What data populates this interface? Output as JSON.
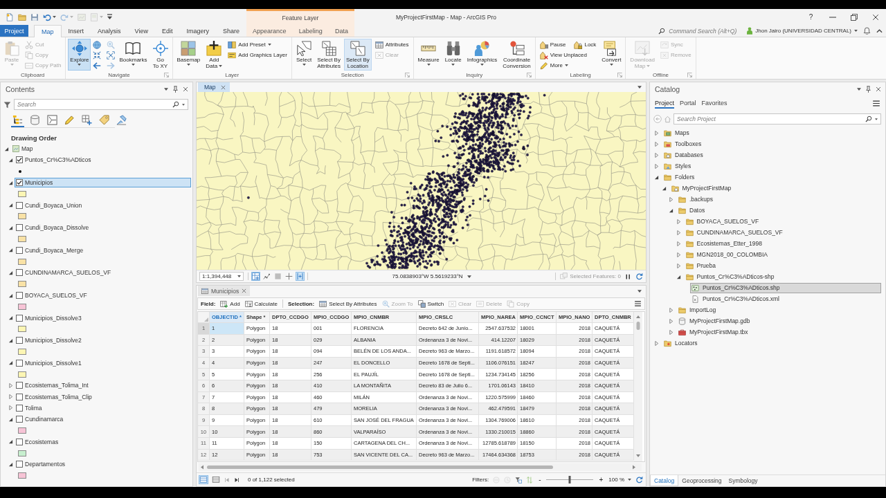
{
  "window": {
    "title": "MyProjectFirstMap - Map - ArcGIS Pro",
    "context_header": "Feature Layer",
    "help": "?"
  },
  "quick_access": [
    {
      "disabled": false,
      "dropdown": false
    },
    {
      "disabled": false,
      "dropdown": false
    },
    {
      "disabled": false,
      "dropdown": false
    },
    {
      "disabled": false,
      "dropdown": true
    },
    {
      "disabled": true,
      "dropdown": true
    },
    {
      "disabled": true,
      "dropdown": false
    },
    {
      "disabled": true,
      "dropdown": true
    },
    {
      "disabled": false,
      "dropdown": false
    }
  ],
  "tabs": [
    {
      "label": "Project",
      "kind": "backstage",
      "selected": false
    },
    {
      "label": "Map",
      "kind": "core",
      "selected": true
    },
    {
      "label": "Insert",
      "kind": "core",
      "selected": false
    },
    {
      "label": "Analysis",
      "kind": "core",
      "selected": false
    },
    {
      "label": "View",
      "kind": "core",
      "selected": false
    },
    {
      "label": "Edit",
      "kind": "core",
      "selected": false
    },
    {
      "label": "Imagery",
      "kind": "core",
      "selected": false
    },
    {
      "label": "Share",
      "kind": "core",
      "selected": false
    },
    {
      "label": "Appearance",
      "kind": "contextual",
      "selected": false
    },
    {
      "label": "Labeling",
      "kind": "contextual",
      "selected": false
    },
    {
      "label": "Data",
      "kind": "contextual",
      "selected": false
    }
  ],
  "command_search": {
    "placeholder": "Command Search (Alt+Q)"
  },
  "user": {
    "name": "Jhon Jairo (UNIVERSIDAD CENTRAL)"
  },
  "ribbon": [
    {
      "label": "Clipboard",
      "launcher": false,
      "columns": [
        {
          "kind": "large",
          "label": "Paste",
          "disabled": true,
          "selected": false,
          "hovered": false,
          "dropdown": true
        },
        {
          "kind": "stack",
          "rows": [
            [
              {
                "kind": "small",
                "label": "Cut",
                "disabled": true,
                "selected": false,
                "hovered": false,
                "dropdown": false
              }
            ],
            [
              {
                "kind": "small",
                "label": "Copy",
                "disabled": true,
                "selected": false,
                "hovered": false,
                "dropdown": false
              }
            ],
            [
              {
                "kind": "small",
                "label": "Copy Path",
                "disabled": true,
                "selected": false,
                "hovered": false,
                "dropdown": false
              }
            ]
          ]
        }
      ]
    },
    {
      "label": "Navigate",
      "launcher": true,
      "columns": [
        {
          "kind": "large",
          "label": "Explore",
          "disabled": false,
          "selected": true,
          "hovered": false,
          "dropdown": true
        },
        {
          "kind": "stack",
          "rows": [
            [
              {
                "kind": "icon",
                "disabled": false,
                "selected": false,
                "hovered": false
              },
              {
                "kind": "icon",
                "disabled": true,
                "selected": false,
                "hovered": false
              }
            ],
            [
              {
                "kind": "icon",
                "disabled": false,
                "selected": false,
                "hovered": false
              },
              {
                "kind": "icon",
                "disabled": false,
                "selected": false,
                "hovered": false
              }
            ],
            [
              {
                "kind": "icon",
                "disabled": false,
                "selected": false,
                "hovered": false
              },
              {
                "kind": "icon",
                "disabled": true,
                "selected": false,
                "hovered": false
              }
            ]
          ]
        },
        {
          "kind": "large",
          "label": "Bookmarks",
          "disabled": false,
          "selected": false,
          "hovered": false,
          "dropdown": true
        },
        {
          "kind": "large",
          "label": "Go\nTo XY",
          "disabled": false,
          "selected": false,
          "hovered": false,
          "dropdown": false
        }
      ]
    },
    {
      "label": "Layer",
      "launcher": false,
      "columns": [
        {
          "kind": "large",
          "label": "Basemap",
          "disabled": false,
          "selected": false,
          "hovered": false,
          "dropdown": true
        },
        {
          "kind": "large",
          "label": "Add\nData",
          "disabled": false,
          "selected": false,
          "hovered": false,
          "dropdown": true
        },
        {
          "kind": "stack",
          "rows": [
            [
              {
                "kind": "small",
                "label": "Add Preset",
                "disabled": false,
                "selected": false,
                "hovered": false,
                "dropdown": true
              }
            ],
            [
              {
                "kind": "small",
                "label": "Add Graphics Layer",
                "disabled": false,
                "selected": false,
                "hovered": false,
                "dropdown": false
              }
            ]
          ]
        }
      ]
    },
    {
      "label": "Selection",
      "launcher": true,
      "columns": [
        {
          "kind": "large",
          "label": "Select",
          "disabled": false,
          "selected": false,
          "hovered": false,
          "dropdown": true
        },
        {
          "kind": "large",
          "label": "Select By\nAttributes",
          "disabled": false,
          "selected": false,
          "hovered": false,
          "dropdown": false
        },
        {
          "kind": "large",
          "label": "Select By\nLocation",
          "disabled": false,
          "selected": false,
          "hovered": true,
          "dropdown": false
        },
        {
          "kind": "stack",
          "rows": [
            [
              {
                "kind": "small",
                "label": "Attributes",
                "disabled": false,
                "selected": false,
                "hovered": false,
                "dropdown": false
              }
            ],
            [
              {
                "kind": "small",
                "label": "Clear",
                "disabled": true,
                "selected": false,
                "hovered": false,
                "dropdown": false
              }
            ]
          ]
        }
      ]
    },
    {
      "label": "Inquiry",
      "launcher": true,
      "columns": [
        {
          "kind": "large",
          "label": "Measure",
          "disabled": false,
          "selected": false,
          "hovered": false,
          "dropdown": true
        },
        {
          "kind": "large",
          "label": "Locate",
          "disabled": false,
          "selected": false,
          "hovered": false,
          "dropdown": true
        },
        {
          "kind": "large",
          "label": "Infographics",
          "disabled": false,
          "selected": false,
          "hovered": false,
          "dropdown": true
        },
        {
          "kind": "large",
          "label": "Coordinate\nConversion",
          "disabled": false,
          "selected": false,
          "hovered": false,
          "dropdown": false
        }
      ]
    },
    {
      "label": "Labeling",
      "launcher": true,
      "columns": [
        {
          "kind": "stack",
          "rows": [
            [
              {
                "kind": "small",
                "label": "Pause",
                "disabled": false,
                "selected": false,
                "hovered": false,
                "dropdown": false
              },
              {
                "kind": "small",
                "label": "Lock",
                "disabled": false,
                "selected": false,
                "hovered": false,
                "dropdown": false
              }
            ],
            [
              {
                "kind": "small",
                "label": "View Unplaced",
                "disabled": false,
                "selected": false,
                "hovered": false,
                "dropdown": false
              }
            ],
            [
              {
                "kind": "small",
                "label": "More",
                "disabled": false,
                "selected": false,
                "hovered": false,
                "dropdown": true
              }
            ]
          ]
        },
        {
          "kind": "large",
          "label": "Convert",
          "disabled": false,
          "selected": false,
          "hovered": false,
          "dropdown": true
        }
      ]
    },
    {
      "label": "Offline",
      "launcher": true,
      "columns": [
        {
          "kind": "large",
          "label": "Download\nMap",
          "disabled": true,
          "selected": false,
          "hovered": false,
          "dropdown": true
        },
        {
          "kind": "stack",
          "rows": [
            [
              {
                "kind": "small",
                "label": "Sync",
                "disabled": true,
                "selected": false,
                "hovered": false,
                "dropdown": false
              }
            ],
            [
              {
                "kind": "small",
                "label": "Remove",
                "disabled": true,
                "selected": false,
                "hovered": false,
                "dropdown": false
              }
            ]
          ]
        }
      ]
    }
  ],
  "contents": {
    "title": "Contents",
    "search": {
      "placeholder": "Search"
    },
    "views": [
      {
        "selected": true
      },
      {
        "selected": false
      },
      {
        "selected": false
      },
      {
        "selected": false
      },
      {
        "selected": false
      },
      {
        "selected": false
      },
      {
        "selected": false
      }
    ],
    "heading": "Drawing Order",
    "map": {
      "name": "Map",
      "expanded": true,
      "children": [
        {
          "name": "Puntos_Cr%C3%ADticos",
          "checked": true,
          "expanded": true,
          "selected": false,
          "symbol": {
            "kind": "point",
            "color": "#111111"
          }
        },
        {
          "name": "Municipios",
          "checked": true,
          "expanded": true,
          "selected": true,
          "symbol": {
            "kind": "polygon",
            "color": "#fdf6b4"
          }
        },
        {
          "name": "Cundi_Boyaca_Union",
          "checked": false,
          "expanded": true,
          "selected": false,
          "symbol": {
            "kind": "polygon",
            "color": "#f9e2a6"
          }
        },
        {
          "name": "Cundi_Boyaca_Dissolve",
          "checked": false,
          "expanded": true,
          "selected": false,
          "symbol": {
            "kind": "polygon",
            "color": "#f9e2a6"
          }
        },
        {
          "name": "Cundi_Boyaca_Merge",
          "checked": false,
          "expanded": true,
          "selected": false,
          "symbol": {
            "kind": "polygon",
            "color": "#f9e2a6"
          }
        },
        {
          "name": "CUNDINAMARCA_SUELOS_VF",
          "checked": false,
          "expanded": true,
          "selected": false,
          "symbol": {
            "kind": "polygon",
            "color": "#f9e2a6"
          }
        },
        {
          "name": "BOYACA_SUELOS_VF",
          "checked": false,
          "expanded": true,
          "selected": false,
          "symbol": {
            "kind": "polygon",
            "color": "#f7c4d6"
          }
        },
        {
          "name": "Municipios_Dissolve3",
          "checked": false,
          "expanded": true,
          "selected": false,
          "symbol": {
            "kind": "polygon",
            "color": "#fdf6b4"
          }
        },
        {
          "name": "Municipios_Dissolve2",
          "checked": false,
          "expanded": true,
          "selected": false,
          "symbol": {
            "kind": "polygon",
            "color": "#fdf6b4"
          }
        },
        {
          "name": "Municipios_Dissolve1",
          "checked": false,
          "expanded": true,
          "selected": false,
          "symbol": {
            "kind": "polygon",
            "color": "#fdf6b4"
          }
        },
        {
          "name": "Ecosistemas_Tolima_Int",
          "checked": false,
          "expanded": false,
          "selected": false
        },
        {
          "name": "Ecosistemas_Tolima_Clip",
          "checked": false,
          "expanded": false,
          "selected": false
        },
        {
          "name": "Tolima",
          "checked": false,
          "expanded": false,
          "selected": false
        },
        {
          "name": "Cundinamarca",
          "checked": false,
          "expanded": true,
          "selected": false,
          "symbol": {
            "kind": "polygon",
            "color": "#f7c4d6"
          }
        },
        {
          "name": "Ecosistemas",
          "checked": false,
          "expanded": true,
          "selected": false,
          "symbol": {
            "kind": "polygon",
            "color": "#c7efcf"
          }
        },
        {
          "name": "Departamentos",
          "checked": false,
          "expanded": true,
          "selected": false,
          "symbol": {
            "kind": "polygon",
            "color": "#f7c4d6"
          }
        }
      ]
    }
  },
  "map_view": {
    "tabs": [
      {
        "label": "Map",
        "selected": true
      }
    ],
    "scale": "1:1,394,448",
    "tools": [
      {
        "on": true
      },
      {
        "on": false
      },
      {
        "on": false
      },
      {
        "on": false
      },
      {
        "on": true
      }
    ],
    "coordinates": "75.0838903°W 5.5619233°N",
    "selected_features": "Selected Features: 0"
  },
  "table": {
    "tab": {
      "label": "Municipios"
    },
    "toolbar": [
      {
        "kind": "label",
        "label": "Field:",
        "disabled": false
      },
      {
        "kind": "button",
        "label": "Add",
        "disabled": false
      },
      {
        "kind": "button",
        "label": "Calculate",
        "disabled": false
      },
      {
        "kind": "label",
        "label": "Selection:",
        "disabled": false
      },
      {
        "kind": "button",
        "label": "Select By Attributes",
        "disabled": false
      },
      {
        "kind": "button",
        "label": "Zoom To",
        "disabled": true
      },
      {
        "kind": "button",
        "label": "Switch",
        "disabled": false
      },
      {
        "kind": "button",
        "label": "Clear",
        "disabled": true
      },
      {
        "kind": "button",
        "label": "Delete",
        "disabled": true
      },
      {
        "kind": "button",
        "label": "Copy",
        "disabled": true
      }
    ],
    "columns": [
      {
        "label": "OBJECTID *",
        "kind": "text",
        "selected": true
      },
      {
        "label": "Shape *",
        "kind": "text",
        "selected": false
      },
      {
        "label": "DPTO_CCDGO",
        "kind": "text",
        "selected": false
      },
      {
        "label": "MPIO_CCDGO",
        "kind": "text",
        "selected": false
      },
      {
        "label": "MPIO_CNMBR",
        "kind": "text",
        "selected": false
      },
      {
        "label": "MPIO_CRSLC",
        "kind": "text",
        "selected": false
      },
      {
        "label": "MPIO_NAREA",
        "kind": "numeric",
        "selected": false
      },
      {
        "label": "MPIO_CCNCT",
        "kind": "text",
        "selected": false
      },
      {
        "label": "MPIO_NANO",
        "kind": "numeric",
        "selected": false
      },
      {
        "label": "DPTO_CNMBR",
        "kind": "text",
        "selected": false
      }
    ],
    "rows": [
      {
        "number": "1",
        "current": true,
        "cells": [
          "1",
          "Polygon",
          "18",
          "001",
          "FLORENCIA",
          "Decreto 642 de Junio...",
          "2547.637532",
          "18001",
          "2018",
          "CAQUETÁ"
        ]
      },
      {
        "number": "2",
        "current": false,
        "cells": [
          "2",
          "Polygon",
          "18",
          "029",
          "ALBANIA",
          "Ordenanza 3 de Novi...",
          "414.12207",
          "18029",
          "2018",
          "CAQUETÁ"
        ]
      },
      {
        "number": "3",
        "current": false,
        "cells": [
          "3",
          "Polygon",
          "18",
          "094",
          "BELÉN DE LOS ANDA...",
          "Decreto 963 de Marzo...",
          "1191.618572",
          "18094",
          "2018",
          "CAQUETÁ"
        ]
      },
      {
        "number": "4",
        "current": false,
        "cells": [
          "4",
          "Polygon",
          "18",
          "247",
          "EL DONCELLO",
          "Decreto 1678 de Septi...",
          "1106.076151",
          "18247",
          "2018",
          "CAQUETÁ"
        ]
      },
      {
        "number": "5",
        "current": false,
        "cells": [
          "5",
          "Polygon",
          "18",
          "256",
          "EL PAUJÍL",
          "Decreto 1678 de Septi...",
          "1234.734145",
          "18256",
          "2018",
          "CAQUETÁ"
        ]
      },
      {
        "number": "6",
        "current": false,
        "cells": [
          "6",
          "Polygon",
          "18",
          "410",
          "LA MONTAÑITA",
          "Decreto 83 de Julio 6...",
          "1701.06143",
          "18410",
          "2018",
          "CAQUETÁ"
        ]
      },
      {
        "number": "7",
        "current": false,
        "cells": [
          "7",
          "Polygon",
          "18",
          "460",
          "MILÁN",
          "Ordenanza 3 de Novi...",
          "1220.575999",
          "18460",
          "2018",
          "CAQUETÁ"
        ]
      },
      {
        "number": "8",
        "current": false,
        "cells": [
          "8",
          "Polygon",
          "18",
          "479",
          "MORELIA",
          "Ordenanza 3 de Novi...",
          "462.479591",
          "18479",
          "2018",
          "CAQUETÁ"
        ]
      },
      {
        "number": "9",
        "current": false,
        "cells": [
          "9",
          "Polygon",
          "18",
          "610",
          "SAN JOSÉ DEL FRAGUA",
          "Ordenanza 3 de Novi...",
          "1304.769006",
          "18610",
          "2018",
          "CAQUETÁ"
        ]
      },
      {
        "number": "10",
        "current": false,
        "cells": [
          "10",
          "Polygon",
          "18",
          "860",
          "VALPARAÍSO",
          "Ordenanza 3 de Novi...",
          "1330.210015",
          "18860",
          "2018",
          "CAQUETÁ"
        ]
      },
      {
        "number": "11",
        "current": false,
        "cells": [
          "11",
          "Polygon",
          "18",
          "150",
          "CARTAGENA DEL CH...",
          "Ordenanza 3 de Novi...",
          "12785.618789",
          "18150",
          "2018",
          "CAQUETÁ"
        ]
      },
      {
        "number": "12",
        "current": false,
        "cells": [
          "12",
          "Polygon",
          "18",
          "753",
          "SAN VICENTE DEL CA...",
          "Decreto 963 de Marzo...",
          "17464.634368",
          "18753",
          "2018",
          "CAQUETÁ"
        ]
      }
    ],
    "footer": {
      "views": [
        {
          "selected": true
        },
        {
          "selected": false
        }
      ],
      "nav": [
        {
          "disabled": true
        },
        {
          "disabled": false
        }
      ],
      "status": "0 of 1,122 selected",
      "filters_label": "Filters:",
      "filters": [
        {
          "disabled": true
        },
        {
          "disabled": true
        },
        {
          "disabled": false
        },
        {
          "disabled": false
        }
      ],
      "zoom_out": "-",
      "zoom_in": "+",
      "zoom": {
        "level": 0.5
      },
      "zoom_value": "100 %"
    }
  },
  "catalog": {
    "title": "Catalog",
    "tabs": [
      {
        "label": "Project",
        "selected": true
      },
      {
        "label": "Portal",
        "selected": false
      },
      {
        "label": "Favorites",
        "selected": false
      }
    ],
    "search": {
      "placeholder": "Search Project"
    },
    "items": [
      {
        "name": "Maps",
        "kind": "maps",
        "expanded": false,
        "selected": false
      },
      {
        "name": "Toolboxes",
        "kind": "toolboxes",
        "expanded": false,
        "selected": false
      },
      {
        "name": "Databases",
        "kind": "databases",
        "expanded": false,
        "selected": false
      },
      {
        "name": "Styles",
        "kind": "styles",
        "expanded": false,
        "selected": false
      },
      {
        "name": "Folders",
        "kind": "folders",
        "expanded": true,
        "selected": false,
        "children": [
          {
            "name": "MyProjectFirstMap",
            "kind": "project_folder",
            "expanded": true,
            "selected": false,
            "children": [
              {
                "name": ".backups",
                "kind": "folder",
                "expanded": false,
                "selected": false
              },
              {
                "name": "Datos",
                "kind": "folder",
                "expanded": true,
                "selected": false,
                "children": [
                  {
                    "name": "BOYACA_SUELOS_VF",
                    "kind": "folder",
                    "expanded": false,
                    "selected": false
                  },
                  {
                    "name": "CUNDINAMARCA_SUELOS_VF",
                    "kind": "folder",
                    "expanded": false,
                    "selected": false
                  },
                  {
                    "name": "Ecosistemas_Etter_1998",
                    "kind": "folder",
                    "expanded": false,
                    "selected": false
                  },
                  {
                    "name": "MGN2018_00_COLOMBIA",
                    "kind": "folder",
                    "expanded": false,
                    "selected": false
                  },
                  {
                    "name": "Prueba",
                    "kind": "folder",
                    "expanded": false,
                    "selected": false
                  },
                  {
                    "name": "Puntos_Cr%C3%ADticos-shp",
                    "kind": "folder",
                    "expanded": true,
                    "selected": false,
                    "children": [
                      {
                        "name": "Puntos_Cr%C3%ADticos.shp",
                        "kind": "shapefile",
                        "selected": true
                      },
                      {
                        "name": "Puntos_Cr%C3%ADticos.xml",
                        "kind": "xml",
                        "selected": false
                      }
                    ]
                  }
                ]
              },
              {
                "name": "ImportLog",
                "kind": "folder",
                "expanded": false,
                "selected": false
              },
              {
                "name": "MyProjectFirstMap.gdb",
                "kind": "geodatabase",
                "expanded": false,
                "selected": false
              },
              {
                "name": "MyProjectFirstMap.tbx",
                "kind": "toolbox",
                "expanded": false,
                "selected": false
              }
            ]
          }
        ]
      },
      {
        "name": "Locators",
        "kind": "locators",
        "expanded": false,
        "selected": false
      }
    ],
    "dock_tabs": [
      {
        "label": "Catalog",
        "selected": true
      },
      {
        "label": "Geoprocessing",
        "selected": false
      },
      {
        "label": "Symbology",
        "selected": false
      }
    ]
  }
}
